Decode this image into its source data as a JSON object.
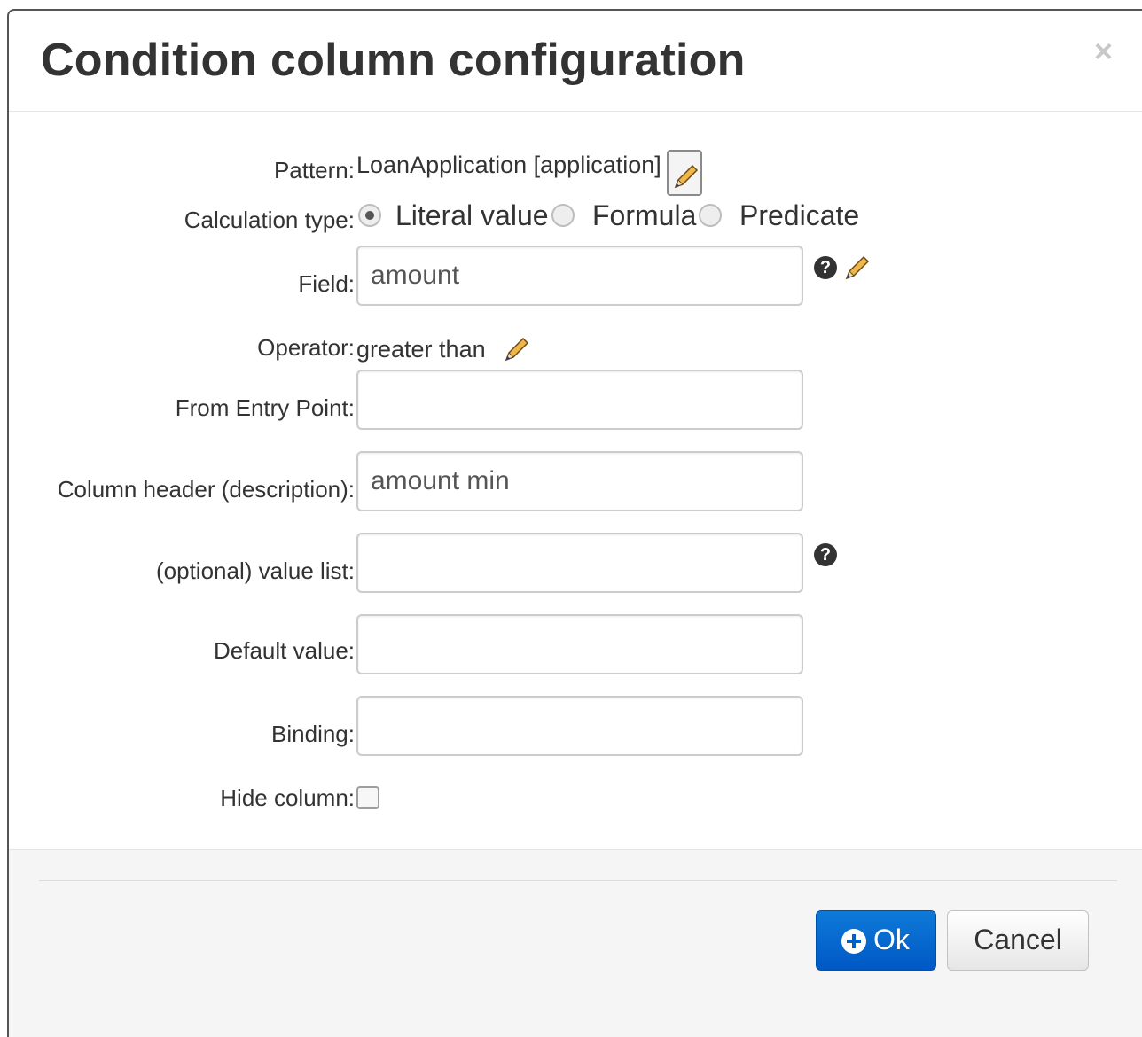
{
  "dialog": {
    "title": "Condition column configuration",
    "close_label": "×"
  },
  "form": {
    "pattern": {
      "label": "Pattern:",
      "value": "LoanApplication [application]"
    },
    "calculation_type": {
      "label": "Calculation type:",
      "options": [
        {
          "label": "Literal value",
          "checked": true
        },
        {
          "label": "Formula",
          "checked": false
        },
        {
          "label": "Predicate",
          "checked": false
        }
      ]
    },
    "field": {
      "label": "Field:",
      "value": "amount",
      "help_icon": "question-circle-icon",
      "edit_icon": "pencil-icon"
    },
    "operator": {
      "label": "Operator:",
      "value": "greater than",
      "edit_icon": "pencil-icon"
    },
    "from_entry_point": {
      "label": "From Entry Point:",
      "value": ""
    },
    "column_header": {
      "label": "Column header (description):",
      "value": "amount min"
    },
    "value_list": {
      "label": "(optional) value list:",
      "value": "",
      "help_icon": "question-circle-icon"
    },
    "default_value": {
      "label": "Default value:",
      "value": ""
    },
    "binding": {
      "label": "Binding:",
      "value": ""
    },
    "hide_column": {
      "label": "Hide column:",
      "checked": false
    }
  },
  "footer": {
    "ok_label": "Ok",
    "ok_icon": "plus-circle-icon",
    "cancel_label": "Cancel"
  },
  "colors": {
    "primary": "#0058c5",
    "text": "#333333",
    "footer_bg": "#f5f5f5"
  }
}
